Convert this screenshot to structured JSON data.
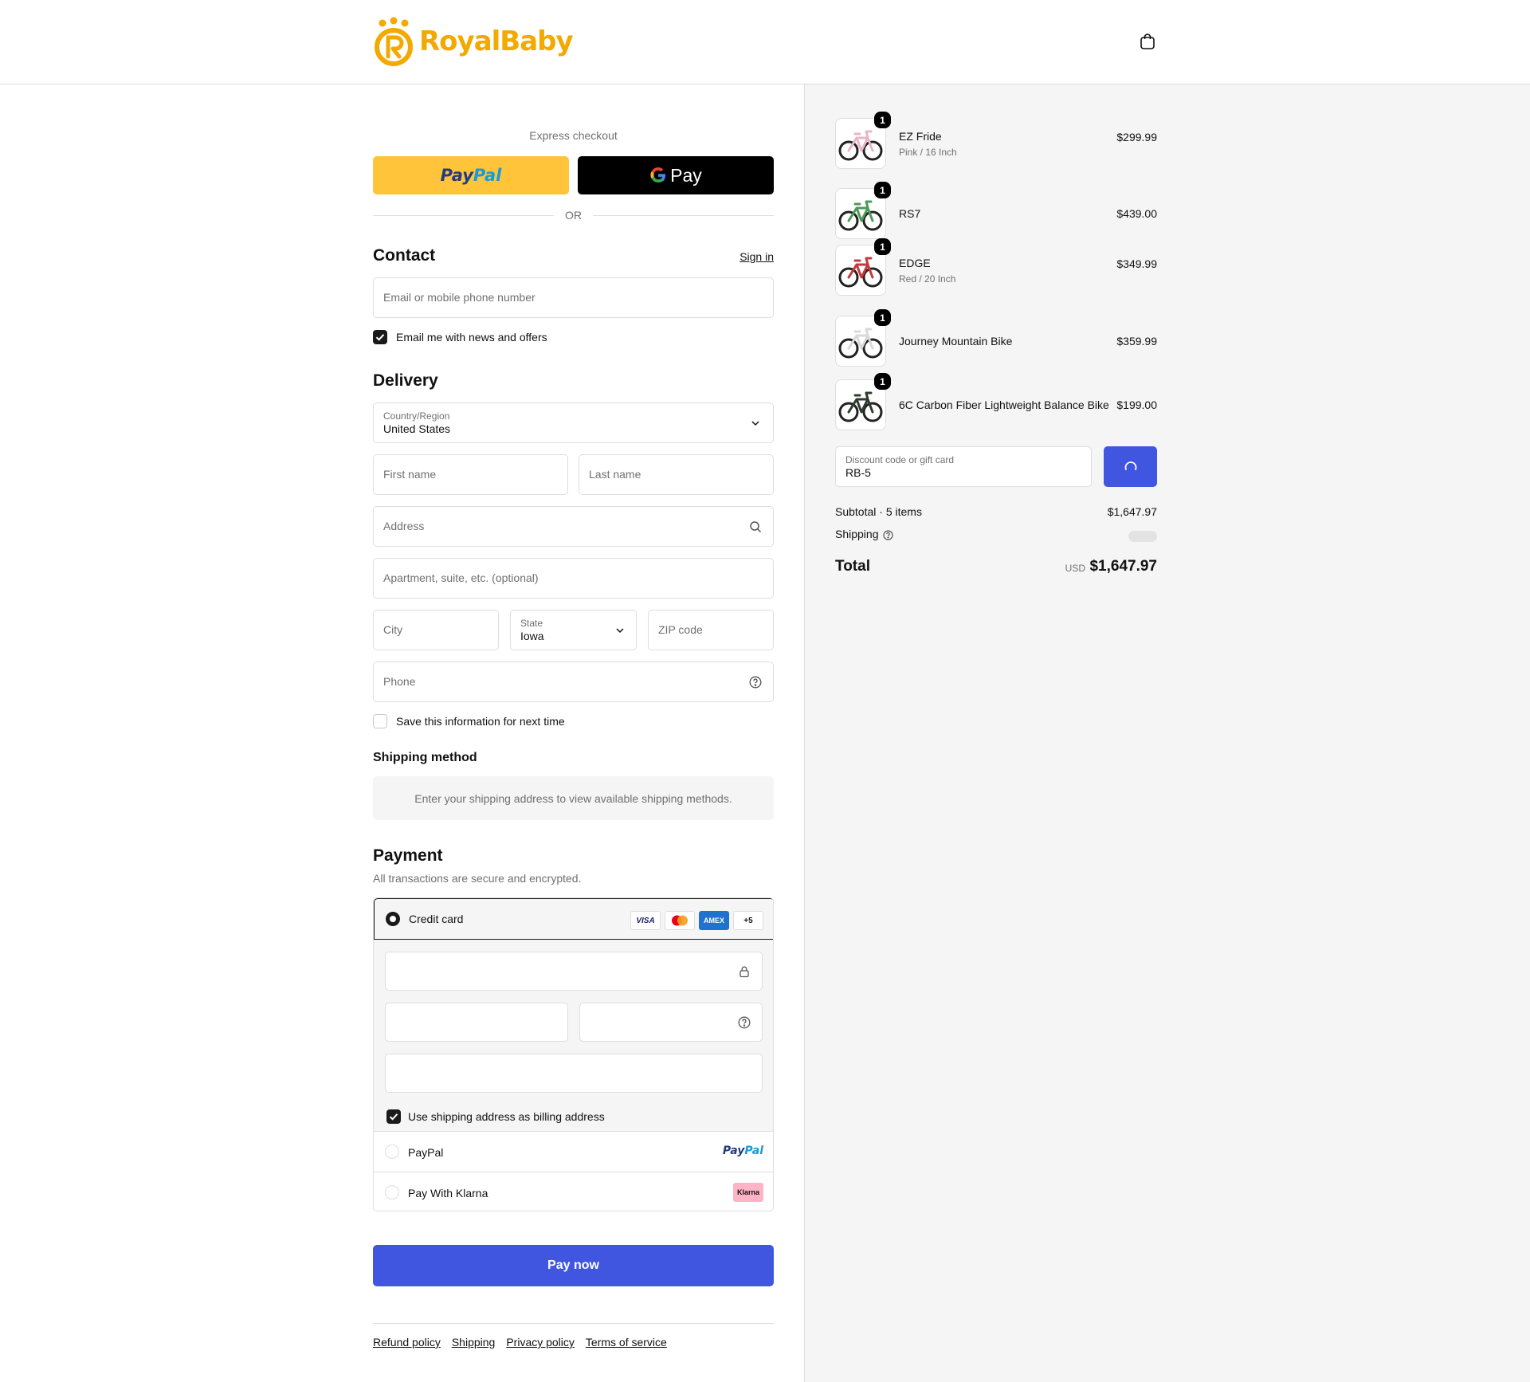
{
  "header": {
    "brand": "RoyalBaby",
    "cart_icon": "shopping-bag-icon"
  },
  "colors": {
    "brand": "#f2a900",
    "accent": "#4056e0",
    "paypal_yellow": "#ffc439"
  },
  "express": {
    "label": "Express checkout",
    "paypal_part1": "Pay",
    "paypal_part2": "Pal",
    "gpay_label": "Pay",
    "or_label": "OR"
  },
  "contact": {
    "title": "Contact",
    "signin_label": "Sign in",
    "email_placeholder": "Email or mobile phone number",
    "news_checkbox_label": "Email me with news and offers",
    "news_checked": true
  },
  "delivery": {
    "title": "Delivery",
    "country_label": "Country/Region",
    "country_value": "United States",
    "first_name_placeholder": "First name",
    "last_name_placeholder": "Last name",
    "address_placeholder": "Address",
    "apartment_placeholder": "Apartment, suite, etc. (optional)",
    "city_placeholder": "City",
    "state_label": "State",
    "state_value": "Iowa",
    "zip_placeholder": "ZIP code",
    "phone_placeholder": "Phone",
    "save_info_label": "Save this information for next time",
    "save_info_checked": false
  },
  "shipping_method": {
    "title": "Shipping method",
    "notice": "Enter your shipping address to view available shipping methods."
  },
  "payment": {
    "title": "Payment",
    "subtitle": "All transactions are secure and encrypted.",
    "credit_card_label": "Credit card",
    "card_badges": [
      "VISA",
      "",
      "AMEX",
      "+5"
    ],
    "billing_label": "Use shipping address as billing address",
    "billing_checked": true,
    "paypal_label": "PayPal",
    "paypal_logo_part1": "Pay",
    "paypal_logo_part2": "Pal",
    "klarna_label": "Pay With Klarna",
    "klarna_logo": "Klarna",
    "pay_now_label": "Pay now"
  },
  "footer": {
    "links": [
      "Refund policy",
      "Shipping",
      "Privacy policy",
      "Terms of service"
    ]
  },
  "order": {
    "items": [
      {
        "name": "EZ Fride",
        "variant": "Pink / 16 Inch",
        "price": "$299.99",
        "qty": "1",
        "frame_color": "#e8b6c4"
      },
      {
        "name": "RS7",
        "variant": "",
        "price": "$439.00",
        "qty": "1",
        "frame_color": "#4d9a5a"
      },
      {
        "name": "EDGE",
        "variant": "Red / 20 Inch",
        "price": "$349.99",
        "qty": "1",
        "frame_color": "#c23a3a"
      },
      {
        "name": "Journey Mountain Bike",
        "variant": "",
        "price": "$359.99",
        "qty": "1",
        "frame_color": "#d9d9d9"
      },
      {
        "name": "6C Carbon Fiber Lightweight Balance Bike",
        "variant": "",
        "price": "$199.00",
        "qty": "1",
        "frame_color": "#2f3b2f"
      }
    ],
    "discount_label": "Discount code or gift card",
    "discount_value": "RB-5",
    "subtotal_label": "Subtotal · 5 items",
    "subtotal_value": "$1,647.97",
    "shipping_label": "Shipping",
    "total_label": "Total",
    "currency": "USD",
    "total_value": "$1,647.97"
  }
}
